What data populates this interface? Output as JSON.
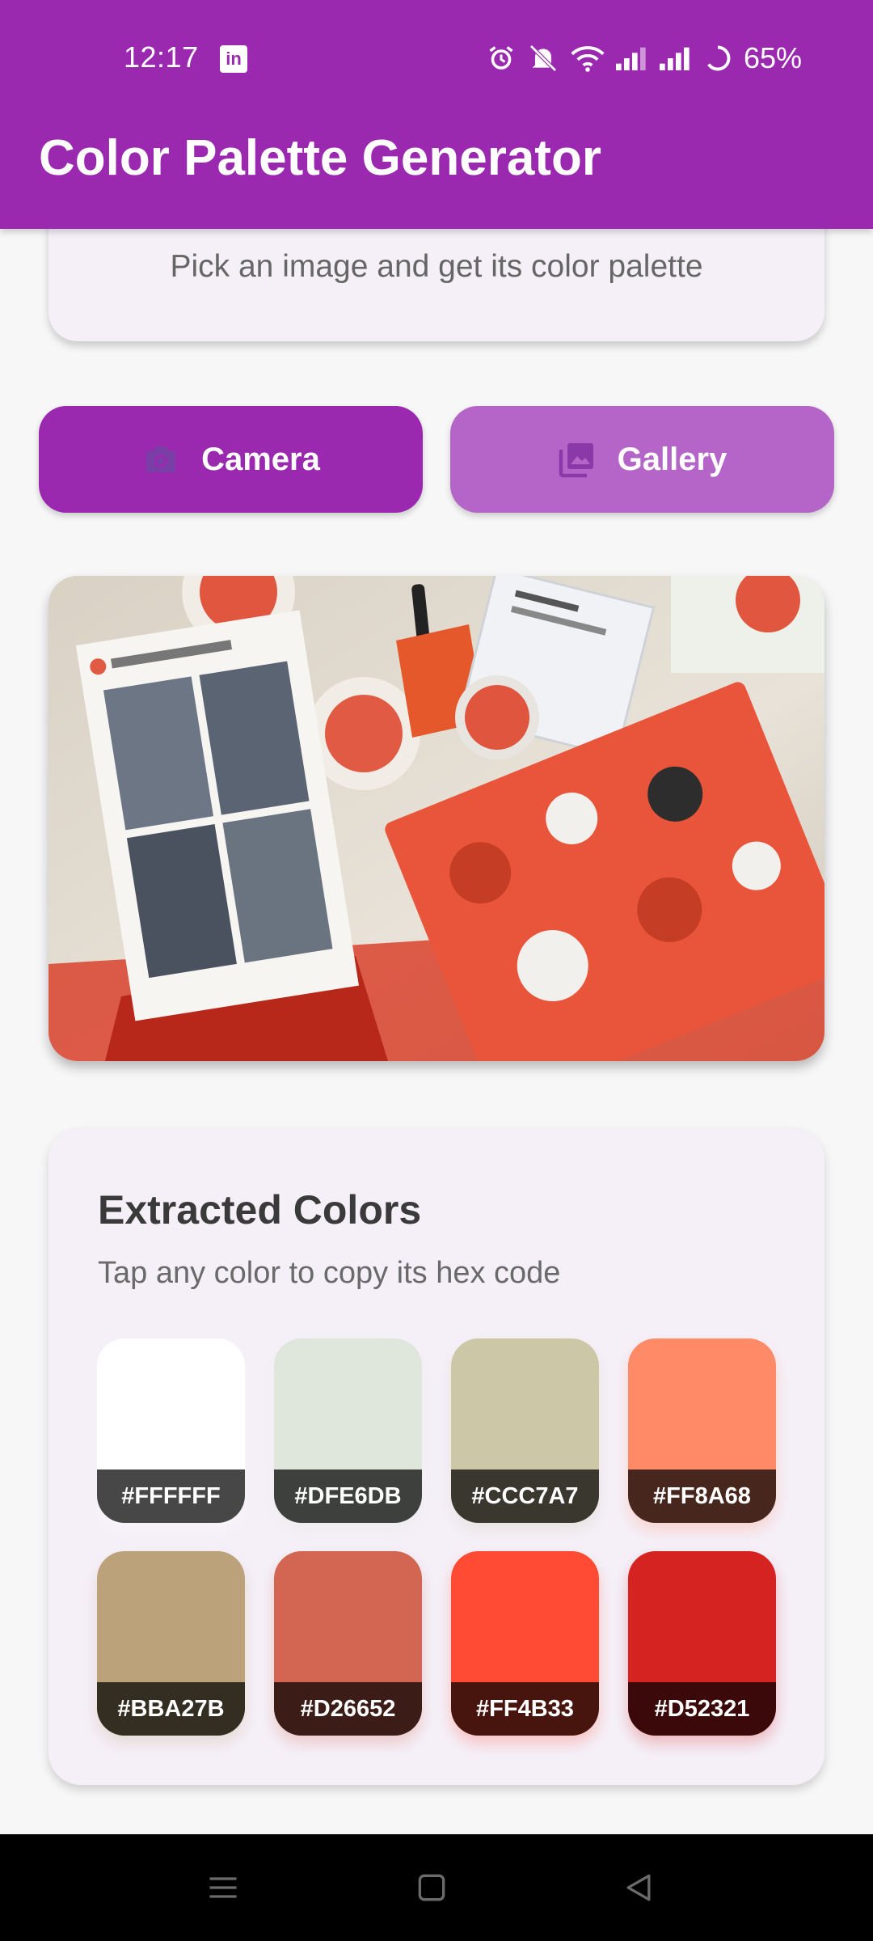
{
  "status_bar": {
    "time": "12:17",
    "linkedin_glyph": "in",
    "battery": "65%",
    "icons": [
      "alarm-icon",
      "mute-icon",
      "wifi-icon",
      "signal-icon",
      "signal-icon",
      "battery-icon"
    ]
  },
  "app_bar": {
    "title": "Color Palette Generator"
  },
  "intro": {
    "description": "Pick an image and get its color palette"
  },
  "actions": {
    "camera": {
      "label": "Camera",
      "icon": "camera-icon"
    },
    "gallery": {
      "label": "Gallery",
      "icon": "gallery-icon"
    }
  },
  "image": {
    "alt": "selected photo"
  },
  "palette": {
    "title": "Extracted Colors",
    "subtitle": "Tap any color to copy its hex code",
    "colors": [
      "#FFFFFF",
      "#DFE6DB",
      "#CCC7A7",
      "#FF8A68",
      "#BBA27B",
      "#D26652",
      "#FF4B33",
      "#D52321"
    ]
  },
  "nav": {
    "icons": [
      "menu-icon",
      "home-icon",
      "back-icon"
    ]
  },
  "theme": {
    "primary": "#9a29b0",
    "primary_light": "#b565c8"
  }
}
